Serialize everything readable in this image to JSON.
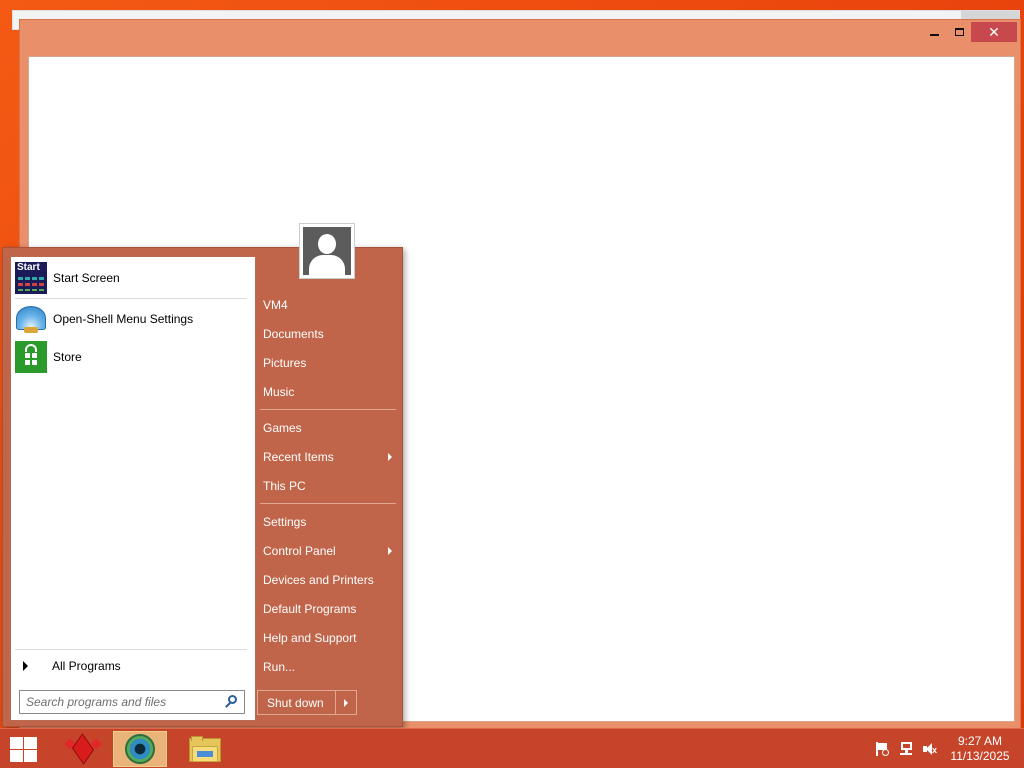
{
  "window": {
    "minimize_glyph": "",
    "close_glyph": "✕"
  },
  "start_menu": {
    "programs": [
      {
        "label": "Start Screen",
        "icon": "start-screen-icon"
      },
      {
        "label": "Open-Shell Menu Settings",
        "icon": "open-shell-icon"
      },
      {
        "label": "Store",
        "icon": "store-icon"
      }
    ],
    "start_icon_text": "Start",
    "all_programs": "All Programs",
    "search_placeholder": "Search programs and files",
    "right_items": [
      {
        "label": "VM4",
        "submenu": false
      },
      {
        "label": "Documents",
        "submenu": false
      },
      {
        "label": "Pictures",
        "submenu": false
      },
      {
        "label": "Music",
        "submenu": false
      },
      {
        "label": "Games",
        "submenu": false
      },
      {
        "label": "Recent Items",
        "submenu": true
      },
      {
        "label": "This PC",
        "submenu": false
      },
      {
        "label": "Settings",
        "submenu": false
      },
      {
        "label": "Control Panel",
        "submenu": true
      },
      {
        "label": "Devices and Printers",
        "submenu": false
      },
      {
        "label": "Default Programs",
        "submenu": false
      },
      {
        "label": "Help and Support",
        "submenu": false
      },
      {
        "label": "Run...",
        "submenu": false
      }
    ],
    "shutdown": "Shut down"
  },
  "taskbar": {
    "time": "9:27 AM",
    "date": "11/13/2025"
  },
  "colors": {
    "desktop": "#f04e0e",
    "menu_bg": "#c0654a",
    "taskbar": "#c6452a",
    "window_frame": "#e9906a",
    "close_button": "#c7484d"
  }
}
